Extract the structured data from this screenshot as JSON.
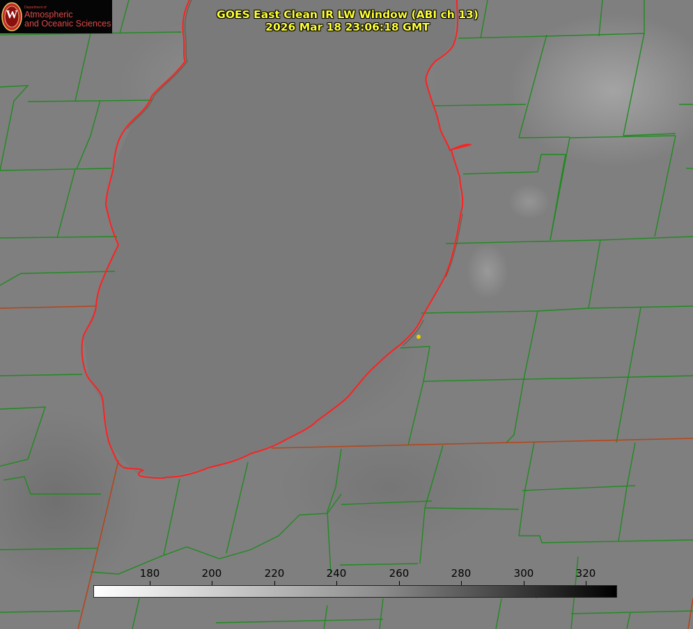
{
  "title": {
    "line1": "GOES East Clean IR LW Window (ABI ch 13)",
    "line2": "2026 Mar 18 23:06:18 GMT"
  },
  "logo": {
    "department": "Department of",
    "line1": "Atmospheric",
    "line2": "and Oceanic Sciences",
    "seal_letter": "W"
  },
  "colorbar": {
    "min": 162,
    "max": 330,
    "ticks": [
      "180",
      "200",
      "220",
      "240",
      "260",
      "280",
      "300",
      "320"
    ],
    "tick_values": [
      180,
      200,
      220,
      240,
      260,
      280,
      300,
      320
    ],
    "gradient": [
      "#ffffff",
      "#8c8c8c",
      "#000000"
    ]
  },
  "colors": {
    "background_gray": "#7d7d7d",
    "county_lines": "#1f8a1f",
    "state_lines": "#b5451a",
    "lake_outline": "#ff2020",
    "title_text": "#ffff33",
    "marker": "#e8d000"
  }
}
